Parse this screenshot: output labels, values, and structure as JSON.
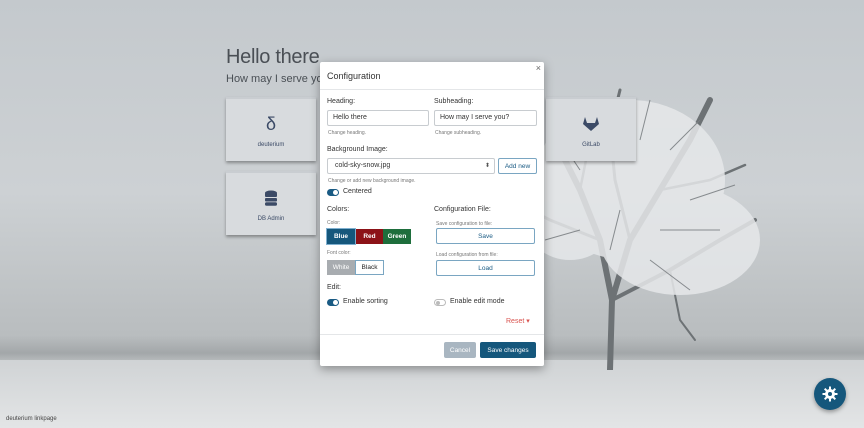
{
  "home": {
    "heading": "Hello there",
    "subheading": "How may I serve you?",
    "tiles": [
      {
        "label": "deuterium",
        "icon": "delta-icon"
      },
      {
        "label": "DB Admin",
        "icon": "database-icon"
      },
      {
        "label": "GitLab",
        "icon": "gitlab-icon"
      }
    ],
    "footer": "deuterium linkpage"
  },
  "modal": {
    "title": "Configuration",
    "close": "×",
    "heading_label": "Heading:",
    "heading_value": "Hello there",
    "heading_hint": "Change heading.",
    "subheading_label": "Subheading:",
    "subheading_value": "How may I serve you?",
    "subheading_hint": "Change subheading.",
    "background_label": "Background Image:",
    "background_value": "cold-sky-snow.jpg",
    "background_caret": "⬍",
    "add_new": "Add new",
    "background_hint": "Change or add new background image.",
    "centered_label": "Centered",
    "colors_label": "Colors:",
    "color_sub": "Color:",
    "color_options": [
      "Blue",
      "Red",
      "Green"
    ],
    "font_color_sub": "Font color:",
    "font_color_options": [
      "White",
      "Black"
    ],
    "config_file_label": "Configuration File:",
    "save_config_sub": "Save configuration to file:",
    "save": "Save",
    "load_config_sub": "Load configuration from file:",
    "load": "Load",
    "edit_label": "Edit:",
    "enable_sorting": "Enable sorting",
    "enable_edit_mode": "Enable edit mode",
    "reset": "Reset ▾",
    "cancel": "Cancel",
    "save_changes": "Save changes"
  },
  "colors": {
    "accent": "#15577c",
    "blue": "#15577c",
    "red": "#8c1217",
    "green": "#1e6e3c",
    "white_btn": "#a8acb0"
  }
}
